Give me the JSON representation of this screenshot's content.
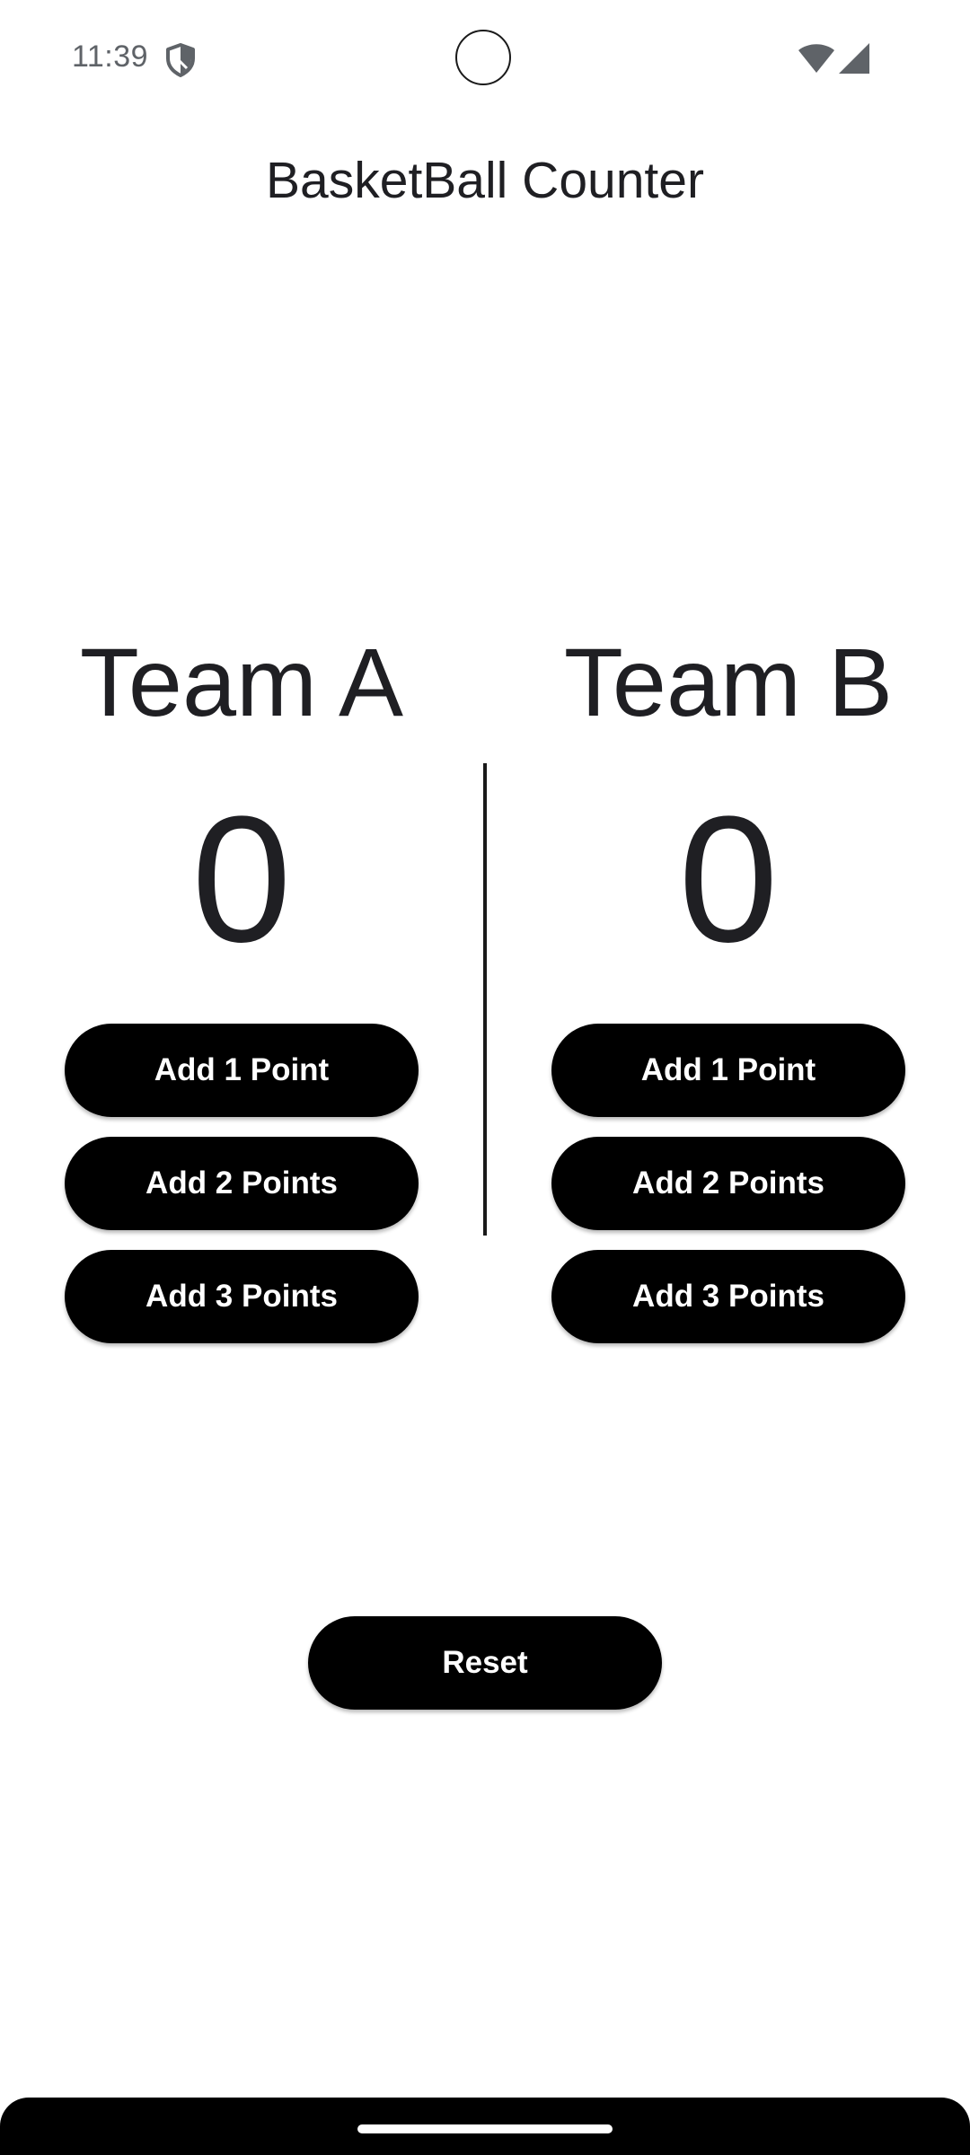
{
  "status_bar": {
    "time": "11:39",
    "icons": [
      "shield-icon",
      "camera-cutout",
      "wifi-icon",
      "signal-icon"
    ]
  },
  "app": {
    "title": "BasketBall Counter"
  },
  "team_a": {
    "name": "Team A",
    "score": "0",
    "buttons": [
      "Add 1 Point",
      "Add 2 Points",
      "Add 3 Points"
    ]
  },
  "team_b": {
    "name": "Team B",
    "score": "0",
    "buttons": [
      "Add 1 Point",
      "Add 2 Points",
      "Add 3 Points"
    ]
  },
  "reset": {
    "label": "Reset"
  },
  "colors": {
    "background": "#ffffff",
    "button": "#000000",
    "button_text": "#ffffff",
    "text": "#1f1f23",
    "status_text": "#5f6368"
  }
}
